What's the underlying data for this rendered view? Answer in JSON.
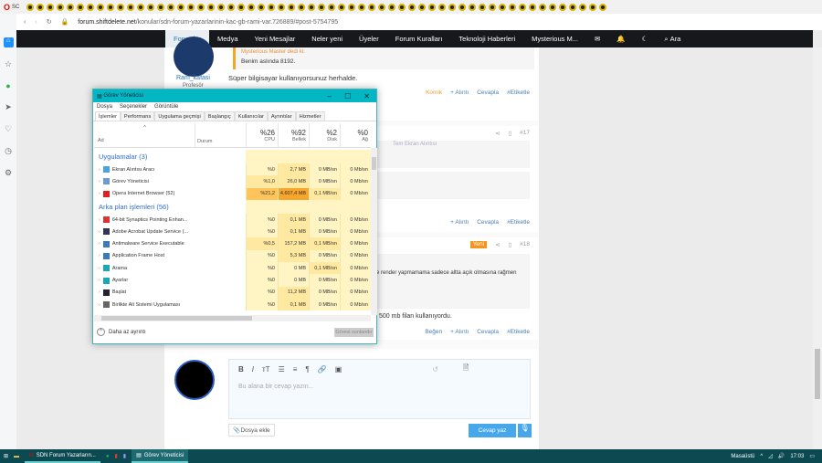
{
  "browser": {
    "tab_label": "SC",
    "url_domain": "forum.shiftdelete.net",
    "url_path": "/konular/sdn-forum-yazarlarinin-kac-gb-rami-var.726889/#post-5754795"
  },
  "nav": {
    "items": [
      "Forumlar",
      "Medya",
      "Yeni Mesajlar",
      "Neler yeni",
      "Üyeler",
      "Forum Kuralları",
      "Teknoloji Haberleri"
    ],
    "user": "Mysterious M...",
    "search": "Ara"
  },
  "post16": {
    "author": "Ram_kafasi",
    "role": "Profesör",
    "quote_author": "Mysterious Master dedi ki:",
    "quote": "Benim aslında 8192.",
    "body": "Süper bilgisayar kullanıyorsunuz herhalde.",
    "reaction": "Komik",
    "actions": [
      "+ Alıntı",
      "Cevapla",
      "#Etiketle"
    ]
  },
  "post17": {
    "number": "#17",
    "quote_label": "Tem Ekran Alıntısı",
    "actions": [
      "+ Alıntı",
      "Cevapla",
      "#Etiketle"
    ]
  },
  "post18": {
    "number": "#18",
    "badge": "Yeni",
    "text1": "e render yapmamama sadece altta açık olmasına rağmen",
    "text2": "500 mb filan kullanıyordu.",
    "actions": [
      "Beğen",
      "+ Alıntı",
      "Cevapla",
      "#Etiketle"
    ]
  },
  "reply": {
    "placeholder": "Bu alana bir cevap yazın...",
    "attach": "Dosya ekle",
    "submit": "Cevap yaz"
  },
  "taskmgr": {
    "title": "Görev Yöneticisi",
    "menu": [
      "Dosya",
      "Seçenekler",
      "Görüntüle"
    ],
    "tabs": [
      "İşlemler",
      "Performans",
      "Uygulama geçmişi",
      "Başlangıç",
      "Kullanıcılar",
      "Ayrıntılar",
      "Hizmetler"
    ],
    "columns": {
      "name": "Ad",
      "status": "Durum",
      "cpu_pct": "%26",
      "cpu": "CPU",
      "mem_pct": "%92",
      "mem": "Bellek",
      "disk_pct": "%2",
      "disk": "Disk",
      "net_pct": "%0",
      "net": "Ağ"
    },
    "group_apps": "Uygulamalar (3)",
    "apps": [
      {
        "name": "Ekran Alıntısı Aracı",
        "cpu": "%0",
        "mem": "2,7 MB",
        "disk": "0 MB/sn",
        "net": "0 Mb/sn"
      },
      {
        "name": "Görev Yöneticisi",
        "cpu": "%1,0",
        "mem": "26,0 MB",
        "disk": "0 MB/sn",
        "net": "0 Mb/sn"
      },
      {
        "name": "Opera Internet Browser (52)",
        "cpu": "%21,2",
        "mem": "4.607,4 MB",
        "disk": "0,1 MB/sn",
        "net": "0 Mb/sn"
      }
    ],
    "group_bg": "Arka plan işlemleri (56)",
    "bg": [
      {
        "name": "64-bit Synaptics Pointing Enhan...",
        "cpu": "%0",
        "mem": "0,1 MB",
        "disk": "0 MB/sn",
        "net": "0 Mb/sn"
      },
      {
        "name": "Adobe Acrobat Update Service (...",
        "cpu": "%0",
        "mem": "0,1 MB",
        "disk": "0 MB/sn",
        "net": "0 Mb/sn"
      },
      {
        "name": "Antimalware Service Executable",
        "cpu": "%0,5",
        "mem": "157,2 MB",
        "disk": "0,1 MB/sn",
        "net": "0 Mb/sn"
      },
      {
        "name": "Application Frame Host",
        "cpu": "%0",
        "mem": "5,3 MB",
        "disk": "0 MB/sn",
        "net": "0 Mb/sn"
      },
      {
        "name": "Arama",
        "cpu": "%0",
        "mem": "0 MB",
        "disk": "0,1 MB/sn",
        "net": "0 Mb/sn"
      },
      {
        "name": "Ayarlar",
        "cpu": "%0",
        "mem": "0 MB",
        "disk": "0 MB/sn",
        "net": "0 Mb/sn"
      },
      {
        "name": "Başlat",
        "cpu": "%0",
        "mem": "11,2 MB",
        "disk": "0 MB/sn",
        "net": "0 Mb/sn"
      },
      {
        "name": "Birlikte Alt Sistemi Uygulaması",
        "cpu": "%0",
        "mem": "0,1 MB",
        "disk": "0 MB/sn",
        "net": "0 Mb/sn"
      }
    ],
    "less_details": "Daha az ayrıntı",
    "end_task": "Görevi sonlandır"
  },
  "taskbar": {
    "apps": [
      "SDN Forum Yazarların...",
      "Görev Yöneticisi"
    ],
    "desktop": "Masaüstü",
    "time": "17:03"
  }
}
